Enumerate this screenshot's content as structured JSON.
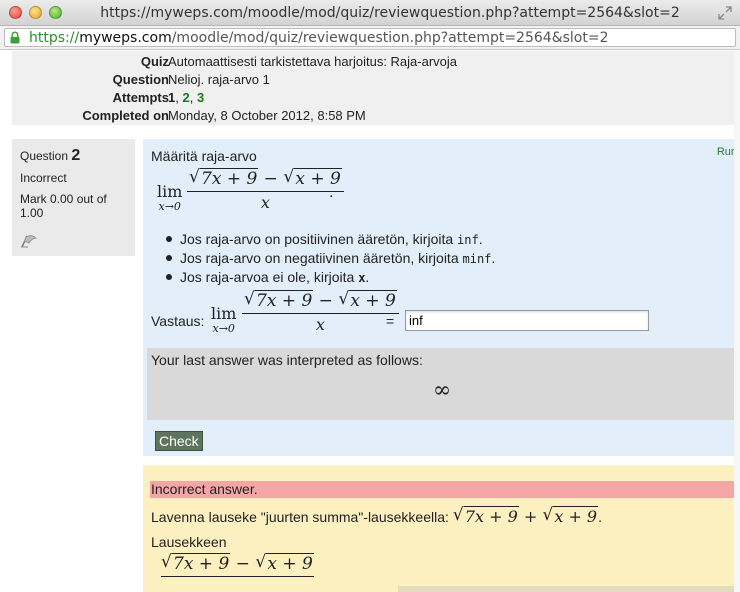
{
  "window": {
    "title": "https://myweps.com/moodle/mod/quiz/reviewquestion.php?attempt=2564&slot=2"
  },
  "urlbar": {
    "scheme": "https://",
    "host": "myweps.com",
    "path": "/moodle/mod/quiz/reviewquestion.php?attempt=2564&slot=2"
  },
  "summary": {
    "quiz_label": "Quiz",
    "quiz_value": "Automaattisesti tarkistettava harjoitus: Raja-arvoja",
    "question_label": "Question",
    "question_value": "Nelioj. raja-arvo 1",
    "attempts_label": "Attempts",
    "attempts": [
      "1",
      "2",
      "3"
    ],
    "attempts_sep": ", ",
    "completed_label": "Completed on",
    "completed_value": "Monday, 8 October 2012, 8:58 PM"
  },
  "question_info": {
    "prefix": "Question",
    "number": "2",
    "state": "Incorrect",
    "mark": "Mark 0.00 out of 1.00"
  },
  "formulation": {
    "run_link": "Run",
    "prompt": "Määritä raja-arvo",
    "lim": "lim",
    "lim_sub": "x→0",
    "sqrt_a": "7x + 9",
    "minus": " − ",
    "sqrt_b": "x + 9",
    "denominator": "x",
    "period": ".",
    "bullets": [
      {
        "text": "Jos raja-arvo on positiivinen ääretön, kirjoita ",
        "code": "inf",
        "end": "."
      },
      {
        "text": "Jos raja-arvo on negatiivinen ääretön, kirjoita ",
        "code": "minf",
        "end": "."
      },
      {
        "text": "Jos raja-arvoa ei ole, kirjoita ",
        "code": "x",
        "end": "."
      }
    ],
    "answer_label": "Vastaus:",
    "equals": "=",
    "answer_value": "inf",
    "interpreted_text": "Your last answer was interpreted as follows:",
    "interpreted_value": "∞",
    "check_label": "Check"
  },
  "feedback": {
    "incorrect": "Incorrect answer.",
    "hint_prefix": "Lavenna lauseke \"juurten summa\"-lausekkeella: ",
    "hint_sqrt_a": "7x + 9",
    "hint_plus": " + ",
    "hint_sqrt_b": "x + 9",
    "hint_end": ".",
    "lausekkeen": "Lausekkeen",
    "expr_sqrt_a": "7x + 9",
    "expr_minus": " − ",
    "expr_sqrt_b": "x + 9"
  }
}
